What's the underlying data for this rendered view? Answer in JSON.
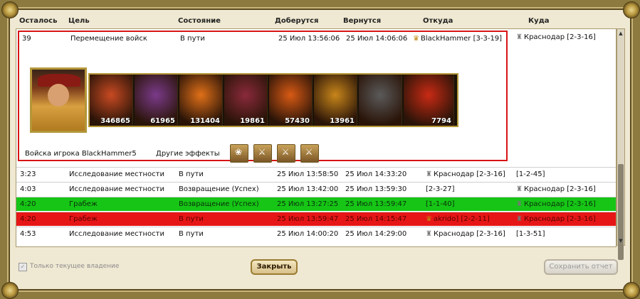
{
  "headers": [
    "Осталось",
    "Цель",
    "Состояние",
    "Доберутся",
    "Вернутся",
    "Откуда",
    "Куда"
  ],
  "detail": {
    "remaining": "39",
    "target": "Перемещение войск",
    "state": "В пути",
    "arrive": "25 Июл 13:56:06",
    "return": "25 Июл 14:06:06",
    "from": "BlackHammer [3-3-19]",
    "to": "Краснодар [2-3-16]",
    "units": [
      {
        "count": "346865",
        "color": "#c84a22"
      },
      {
        "count": "61965",
        "color": "#7a3a8a"
      },
      {
        "count": "131404",
        "color": "#e07018"
      },
      {
        "count": "19861",
        "color": "#8a2a3a"
      },
      {
        "count": "57430",
        "color": "#d85a14"
      },
      {
        "count": "13961",
        "color": "#c8861a"
      },
      {
        "count": "",
        "color": "#5a5a5a"
      },
      {
        "count": "7794",
        "color": "#c82a14"
      }
    ],
    "player_troops_label": "Войска игрока BlackHammer5",
    "other_effects_label": "Другие эффекты",
    "effects": [
      "❀",
      "⚔",
      "⚔",
      "⚔"
    ]
  },
  "rows": [
    {
      "remaining": "3:23",
      "target": "Исследование местности",
      "state": "В пути",
      "arrive": "25 Июл 13:58:50",
      "return": "25 Июл 14:33:20",
      "from": "Краснодар [2-3-16]",
      "from_icon": "castle",
      "to": "[1-2-45]",
      "to_icon": "",
      "style": ""
    },
    {
      "remaining": "4:03",
      "target": "Исследование местности",
      "state": "Возвращение (Успех)",
      "arrive": "25 Июл 13:42:00",
      "return": "25 Июл 13:59:30",
      "from": "[2-3-27]",
      "from_icon": "",
      "to": "Краснодар [2-3-16]",
      "to_icon": "castle",
      "style": ""
    },
    {
      "remaining": "4:20",
      "target": "Грабеж",
      "state": "Возвращение (Успех)",
      "arrive": "25 Июл 13:27:25",
      "return": "25 Июл 13:59:47",
      "from": "[1-1-40]",
      "from_icon": "",
      "to": "Краснодар [2-3-16]",
      "to_icon": "castle",
      "style": "green"
    },
    {
      "remaining": "4:20",
      "target": "Грабеж",
      "state": "В пути",
      "arrive": "25 Июл 13:59:47",
      "return": "25 Июл 14:15:47",
      "from": "akrido] [2-2-11]",
      "from_icon": "crown",
      "to": "Краснодар [2-3-16]",
      "to_icon": "castle",
      "style": "red"
    },
    {
      "remaining": "4:53",
      "target": "Исследование местности",
      "state": "В пути",
      "arrive": "25 Июл 14:00:20",
      "return": "25 Июл 14:29:00",
      "from": "Краснодар [2-3-16]",
      "from_icon": "castle",
      "to": "[1-3-51]",
      "to_icon": "",
      "style": ""
    }
  ],
  "footer": {
    "only_current_label": "Только текущее владение",
    "only_current_checked": true,
    "close_label": "Закрыть",
    "save_label": "Сохранить отчет"
  }
}
